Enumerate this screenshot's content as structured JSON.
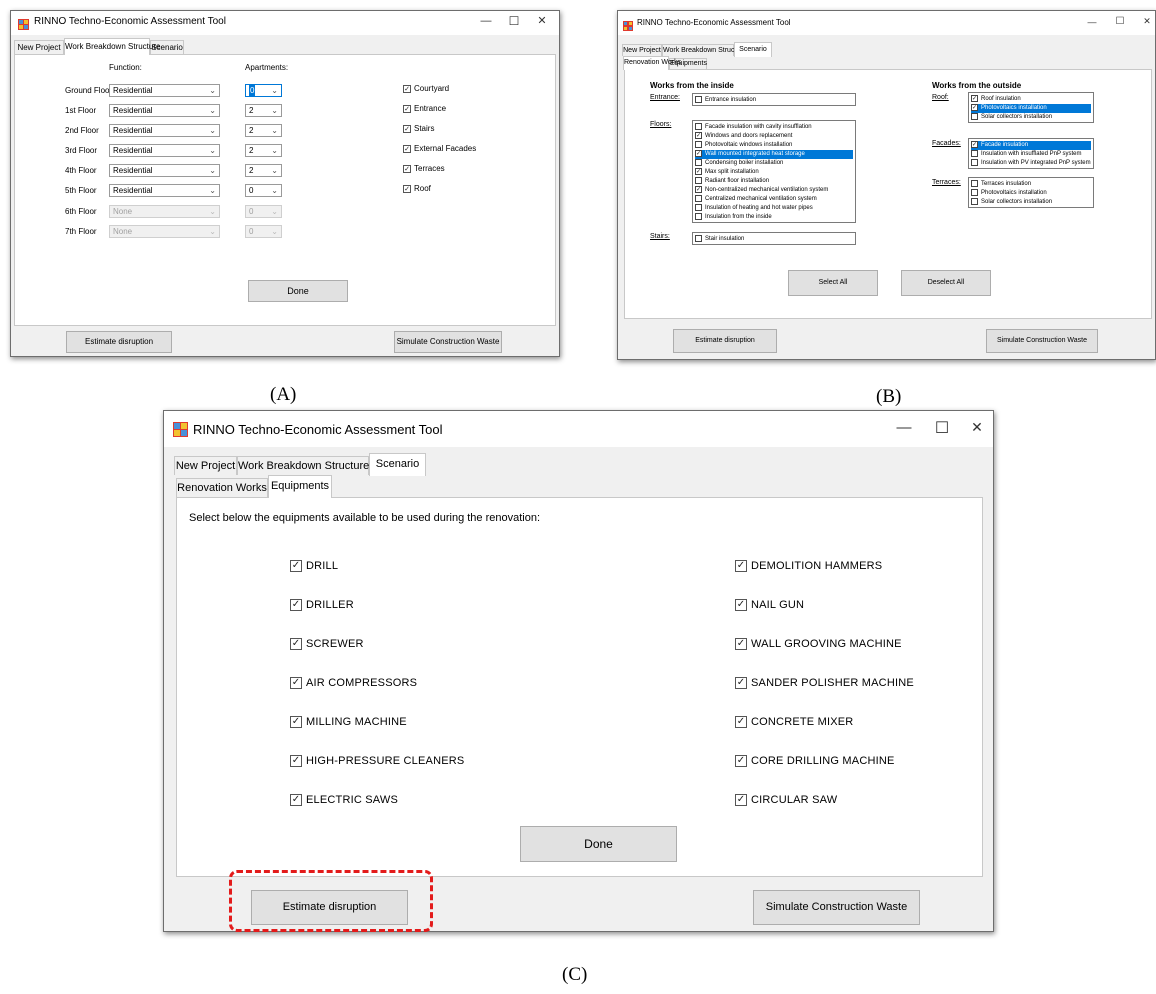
{
  "window_title": "RINNO Techno-Economic Assessment Tool",
  "controls": {
    "minimize": "—",
    "maximize": "☐",
    "close": "✕"
  },
  "tabs": [
    "New Project",
    "Work Breakdown Structure",
    "Scenario"
  ],
  "subtabs": [
    "Renovation Works",
    "Equipments"
  ],
  "bottom_buttons": {
    "estimate": "Estimate disruption",
    "simulate": "Simulate Construction Waste"
  },
  "panel_a": {
    "caption": "(A)",
    "function_header": "Function:",
    "apartments_header": "Apartments:",
    "floors": [
      {
        "label": "Ground Floor",
        "function": "Residential",
        "apartments": "0",
        "enabled": true
      },
      {
        "label": "1st Floor",
        "function": "Residential",
        "apartments": "2",
        "enabled": true
      },
      {
        "label": "2nd Floor",
        "function": "Residential",
        "apartments": "2",
        "enabled": true
      },
      {
        "label": "3rd Floor",
        "function": "Residential",
        "apartments": "2",
        "enabled": true
      },
      {
        "label": "4th Floor",
        "function": "Residential",
        "apartments": "2",
        "enabled": true
      },
      {
        "label": "5th Floor",
        "function": "Residential",
        "apartments": "0",
        "enabled": true
      },
      {
        "label": "6th Floor",
        "function": "None",
        "apartments": "0",
        "enabled": false
      },
      {
        "label": "7th Floor",
        "function": "None",
        "apartments": "0",
        "enabled": false
      }
    ],
    "areas": [
      {
        "label": "Courtyard",
        "checked": true
      },
      {
        "label": "Entrance",
        "checked": true
      },
      {
        "label": "Stairs",
        "checked": true
      },
      {
        "label": "External Facades",
        "checked": true
      },
      {
        "label": "Terraces",
        "checked": true
      },
      {
        "label": "Roof",
        "checked": true
      }
    ],
    "done_label": "Done"
  },
  "panel_b": {
    "caption": "(B)",
    "inside_header": "Works from the inside",
    "outside_header": "Works from the outside",
    "entrance_label": "Entrance:",
    "entrance_items": [
      {
        "label": "Entrance insulation",
        "checked": false,
        "selected": false
      }
    ],
    "floors_label": "Floors:",
    "floors_items": [
      {
        "label": "Facade insulation with cavity insufflation",
        "checked": false,
        "selected": false
      },
      {
        "label": "Windows and doors replacement",
        "checked": true,
        "selected": false
      },
      {
        "label": "Photovoltaic windows installation",
        "checked": false,
        "selected": false
      },
      {
        "label": "Wall mounted integrated heat storage",
        "checked": true,
        "selected": true
      },
      {
        "label": "Condensing boiler installation",
        "checked": false,
        "selected": false
      },
      {
        "label": "Max split installation",
        "checked": true,
        "selected": false
      },
      {
        "label": "Radiant floor installation",
        "checked": false,
        "selected": false
      },
      {
        "label": "Non-centralized mechanical ventilation system",
        "checked": true,
        "selected": false
      },
      {
        "label": "Centralized mechanical ventilation system",
        "checked": false,
        "selected": false
      },
      {
        "label": "Insulation of heating and hot water pipes",
        "checked": false,
        "selected": false
      },
      {
        "label": "Insulation from the inside",
        "checked": false,
        "selected": false
      }
    ],
    "stairs_label": "Stairs:",
    "stairs_items": [
      {
        "label": "Stair insulation",
        "checked": false,
        "selected": false
      }
    ],
    "roof_label": "Roof:",
    "roof_items": [
      {
        "label": "Roof insulation",
        "checked": true,
        "selected": false
      },
      {
        "label": "Photovoltaics installation",
        "checked": true,
        "selected": true
      },
      {
        "label": "Solar collectors installation",
        "checked": false,
        "selected": false
      }
    ],
    "facades_label": "Facades:",
    "facades_items": [
      {
        "label": "Facade insulation",
        "checked": true,
        "selected": true
      },
      {
        "label": "Insulation with insufflated PnP system",
        "checked": false,
        "selected": false
      },
      {
        "label": "Insulation with PV integrated PnP system",
        "checked": false,
        "selected": false
      }
    ],
    "terraces_label": "Terraces:",
    "terraces_items": [
      {
        "label": "Terraces insulation",
        "checked": false,
        "selected": false
      },
      {
        "label": "Photovoltaics installation",
        "checked": false,
        "selected": false
      },
      {
        "label": "Solar collectors installation",
        "checked": false,
        "selected": false
      }
    ],
    "select_all": "Select All",
    "deselect_all": "Deselect All"
  },
  "panel_c": {
    "caption": "(C)",
    "instruction": "Select below the equipments available to be used during the renovation:",
    "left_equipment": [
      {
        "label": "DRILL",
        "checked": true
      },
      {
        "label": "DRILLER",
        "checked": true
      },
      {
        "label": "SCREWER",
        "checked": true
      },
      {
        "label": "AIR COMPRESSORS",
        "checked": true
      },
      {
        "label": "MILLING MACHINE",
        "checked": true
      },
      {
        "label": "HIGH-PRESSURE CLEANERS",
        "checked": true
      },
      {
        "label": "ELECTRIC SAWS",
        "checked": true
      }
    ],
    "right_equipment": [
      {
        "label": "DEMOLITION HAMMERS",
        "checked": true
      },
      {
        "label": "NAIL GUN",
        "checked": true
      },
      {
        "label": "WALL GROOVING MACHINE",
        "checked": true
      },
      {
        "label": "SANDER POLISHER MACHINE",
        "checked": true
      },
      {
        "label": "CONCRETE MIXER",
        "checked": true
      },
      {
        "label": "CORE DRILLING MACHINE",
        "checked": true
      },
      {
        "label": "CIRCULAR SAW",
        "checked": true
      }
    ],
    "done_label": "Done"
  },
  "colors": {
    "selection": "#0078d7",
    "highlight": "#e31b1b",
    "window_bg": "#f0f0f0"
  }
}
